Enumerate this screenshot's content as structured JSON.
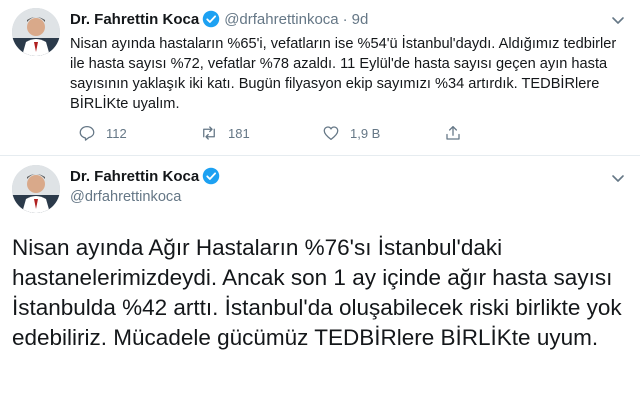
{
  "tweet1": {
    "author_name": "Dr. Fahrettin Koca",
    "handle": "@drfahrettinkoca",
    "separator": "·",
    "time": "9d",
    "text": "Nisan ayında hastaların %65'i, vefatların ise %54'ü İstanbul'daydı. Aldığımız tedbirler ile hasta sayısı %72, vefatlar %78 azaldı. 11 Eylül'de hasta sayısı geçen ayın hasta sayısının yaklaşık iki katı. Bugün filyasyon ekip sayımızı %34 artırdık. TEDBİRlere BİRLİKte uyalım.",
    "reply_count": "112",
    "retweet_count": "181",
    "like_count": "1,9 B",
    "icons": {
      "reply": "reply-icon",
      "retweet": "retweet-icon",
      "like": "heart-icon",
      "share": "share-icon"
    }
  },
  "tweet2": {
    "author_name": "Dr. Fahrettin Koca",
    "handle": "@drfahrettinkoca",
    "text": "Nisan ayında Ağır Hastaların %76'sı İstanbul'daki hastanelerimizdeydi. Ancak son 1 ay içinde ağır hasta sayısı İstanbulda %42 arttı. İstanbul'da oluşabilecek riski birlikte yok edebiliriz. Mücadele gücümüz TEDBİRlere BİRLİKte uyum."
  },
  "colors": {
    "verified": "#1da1f2",
    "muted": "#657786",
    "text": "#14171a"
  }
}
